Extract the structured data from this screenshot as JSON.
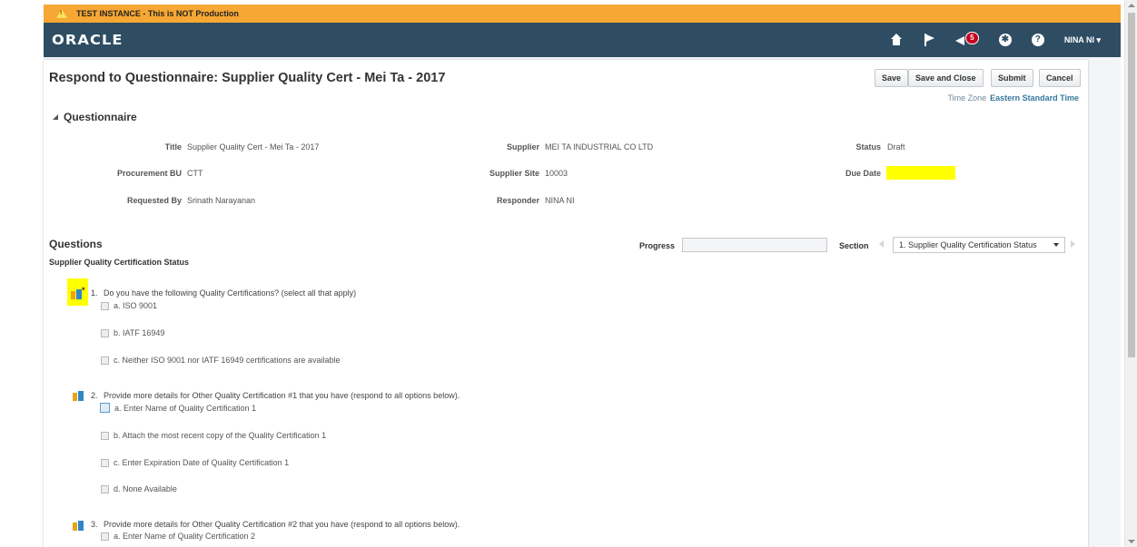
{
  "banner": {
    "text": "TEST INSTANCE - This is NOT Production"
  },
  "header": {
    "logo": "ORACLE",
    "notification_count": "5",
    "user": "NINA NI ▾"
  },
  "page": {
    "title": "Respond to Questionnaire: Supplier Quality Cert - Mei Ta - 2017",
    "buttons": {
      "save": "Save",
      "save_close": "Save and Close",
      "submit": "Submit",
      "cancel": "Cancel"
    },
    "timezone_label": "Time Zone",
    "timezone_value": "Eastern Standard Time"
  },
  "questionnaire": {
    "header": "Questionnaire",
    "title_label": "Title",
    "title_value": "Supplier Quality Cert - Mei Ta - 2017",
    "supplier_label": "Supplier",
    "supplier_value": "MEI TA INDUSTRIAL CO LTD",
    "status_label": "Status",
    "status_value": "Draft",
    "bu_label": "Procurement BU",
    "bu_value": "CTT",
    "site_label": "Supplier Site",
    "site_value": "10003",
    "due_label": "Due Date",
    "due_value": "",
    "requested_label": "Requested By",
    "requested_value": "Srinath Narayanan",
    "responder_label": "Responder",
    "responder_value": "NINA NI"
  },
  "questions": {
    "title": "Questions",
    "subtitle": "Supplier Quality Certification Status",
    "progress_label": "Progress",
    "progress_fraction": 0,
    "section_label": "Section",
    "section_value": "1. Supplier Quality Certification Status",
    "required_mark": "*",
    "items": [
      {
        "num": "1.",
        "text": "Do you have the following Quality Certifications? (select all that apply)",
        "options": [
          "a. ISO 9001",
          "b. IATF 16949",
          "c. Neither ISO 9001 nor IATF 16949 certifications are available"
        ]
      },
      {
        "num": "2.",
        "text": "Provide more details for Other Quality Certification #1 that you have (respond to all options below).",
        "options": [
          "a. Enter Name of Quality Certification 1",
          "b. Attach the most recent copy of the Quality Certification 1",
          "c. Enter Expiration Date of Quality Certification 1",
          "d. None Available"
        ]
      },
      {
        "num": "3.",
        "text": "Provide more details for Other Quality Certification #2 that you have (respond to all options below).",
        "options": [
          "a. Enter Name of Quality Certification 2"
        ]
      }
    ]
  },
  "colors": {
    "banner": "#f7a733",
    "topbar": "#2e4d63",
    "highlight": "#ffff00",
    "badge": "#c6001e"
  }
}
